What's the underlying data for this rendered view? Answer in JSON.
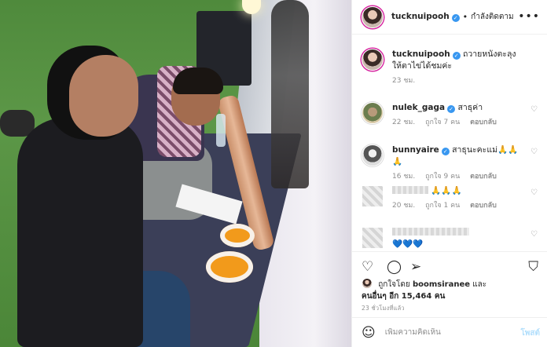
{
  "header": {
    "username": "tucknuipooh",
    "verified_mark": "✓",
    "separator": "•",
    "follow_label": "กำลังติดตาม"
  },
  "caption": {
    "username": "tucknuipooh",
    "text": "ถวายหนังตะลุงให้ตาไข่ได้ชมค่ะ",
    "time": "23 ชม."
  },
  "comments": [
    {
      "username": "nulek_gaga",
      "text": "สาธุค่า",
      "time": "22 ชม.",
      "likes": "ถูกใจ 7 คน",
      "reply": "ตอบกลับ"
    },
    {
      "username": "bunnyaire",
      "text": "สาธุนะคะแม่🙏🙏🙏",
      "time": "16 ชม.",
      "likes": "ถูกใจ 9 คน",
      "reply": "ตอบกลับ"
    },
    {
      "username": "",
      "text": "🙏🙏🙏",
      "time": "20 ชม.",
      "likes": "ถูกใจ 1 คน",
      "reply": "ตอบกลับ"
    },
    {
      "username": "",
      "text": "💙💙💙",
      "time": "",
      "likes": "",
      "reply": ""
    }
  ],
  "actions": {
    "like_icon": "heart-icon",
    "comment_icon": "comment-icon",
    "share_icon": "share-icon",
    "save_icon": "bookmark-icon"
  },
  "likes": {
    "prefix": "ถูกใจโดย",
    "user": "boomsiranee",
    "and": "และ",
    "others": "คนอื่นๆ อีก 15,464 คน"
  },
  "timestamp": "23 ชั่วโมงที่แล้ว",
  "add_comment": {
    "placeholder": "เพิ่มความคิดเห็น",
    "post_label": "โพสต์"
  },
  "colors": {
    "verified": "#3897f0",
    "post_disabled": "#b2dffc",
    "muted": "#8e8e8e"
  }
}
